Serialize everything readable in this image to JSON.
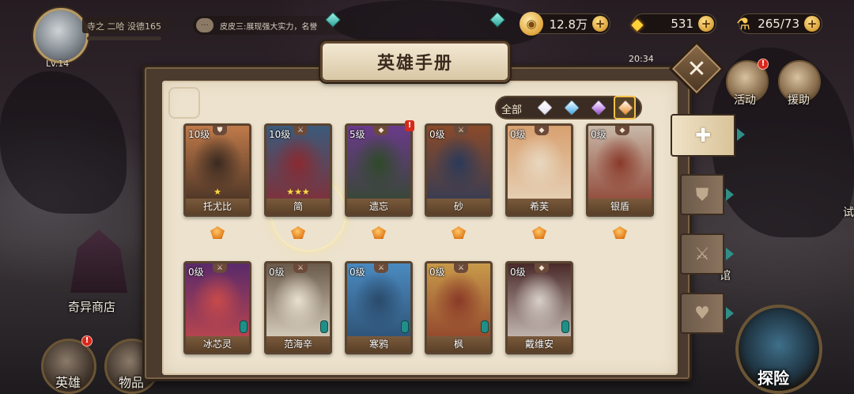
{
  "player": {
    "level_label": "Lv.14",
    "name_text": "寺之 二哈 没德165"
  },
  "chat": {
    "icon": "chat-bubble-icon",
    "message": "皮皮三:展现强大实力，名誉"
  },
  "currencies": [
    {
      "icon": "gold-coin-icon",
      "value": "12.8万"
    },
    {
      "icon": "diamond-gem-icon",
      "value": "531"
    },
    {
      "icon": "stamina-icon",
      "value": "265/73"
    }
  ],
  "clock": "20:34",
  "side_menu": [
    {
      "label": "活动",
      "icon": "activity-icon",
      "alert": "!"
    },
    {
      "label": "援助",
      "icon": "assist-icon"
    }
  ],
  "map_labels": {
    "shop": "奇异商店",
    "hall": "馆",
    "edge": "试"
  },
  "bottom_nav": [
    {
      "label": "英雄",
      "alert": "!"
    },
    {
      "label": "物品"
    }
  ],
  "explore_label": "探险",
  "panel": {
    "title": "英雄手册",
    "filter": {
      "all_label": "全部",
      "gems": [
        {
          "icon": "white-gem-icon",
          "color": "#e6e2f5"
        },
        {
          "icon": "blue-gem-icon",
          "color": "#3aa8e8"
        },
        {
          "icon": "purple-gem-icon",
          "color": "#9a47d8"
        },
        {
          "icon": "orange-gem-icon",
          "color": "#f08a22"
        }
      ],
      "selected_index": 3
    },
    "tabs": [
      {
        "icon": "grid-all-icon",
        "glyph": "✚",
        "active": true
      },
      {
        "icon": "shield-class-icon",
        "glyph": "⛊",
        "active": false
      },
      {
        "icon": "sword-class-icon",
        "glyph": "⚔",
        "active": false
      },
      {
        "icon": "heart-class-icon",
        "glyph": "♥",
        "active": false
      }
    ],
    "heroes": [
      {
        "name": "托尤比",
        "level": "10级",
        "stars": "★",
        "art_top": "#c07a4a",
        "art_bottom": "#3a2a20",
        "class": "tank"
      },
      {
        "name": "简",
        "level": "10级",
        "stars": "★★★",
        "art_top": "#3b5a7a",
        "art_bottom": "#8a2a30",
        "class": "warrior"
      },
      {
        "name": "遗忘",
        "level": "5级",
        "stars": "",
        "art_top": "#6a3a8a",
        "art_bottom": "#2f4a28",
        "class": "support",
        "alert": "!"
      },
      {
        "name": "砂",
        "level": "0级",
        "stars": "",
        "art_top": "#8a4a2a",
        "art_bottom": "#2a3a5a",
        "class": "warrior"
      },
      {
        "name": "希芙",
        "level": "0级",
        "stars": "",
        "art_top": "#d8a070",
        "art_bottom": "#e8d8c0",
        "class": "support"
      },
      {
        "name": "银盾",
        "level": "0级",
        "stars": "",
        "art_top": "#c8b8a8",
        "art_bottom": "#8a3a2a",
        "class": "support"
      },
      {
        "name": "冰芯灵",
        "level": "0级",
        "stars": "",
        "art_top": "#5a2a6a",
        "art_bottom": "#c84a4a",
        "class": "warrior"
      },
      {
        "name": "范海辛",
        "level": "0级",
        "stars": "",
        "art_top": "#6a5a4a",
        "art_bottom": "#e8e0d0",
        "class": "warrior"
      },
      {
        "name": "寒鸦",
        "level": "0级",
        "stars": "",
        "art_top": "#4a8ac0",
        "art_bottom": "#2a4a6a",
        "class": "warrior"
      },
      {
        "name": "枫",
        "level": "0级",
        "stars": "",
        "art_top": "#c89a4a",
        "art_bottom": "#8a3a28",
        "class": "warrior"
      },
      {
        "name": "戴维安",
        "level": "0级",
        "stars": "",
        "art_top": "#4a2a2a",
        "art_bottom": "#d8d0c8",
        "class": "support"
      }
    ]
  }
}
